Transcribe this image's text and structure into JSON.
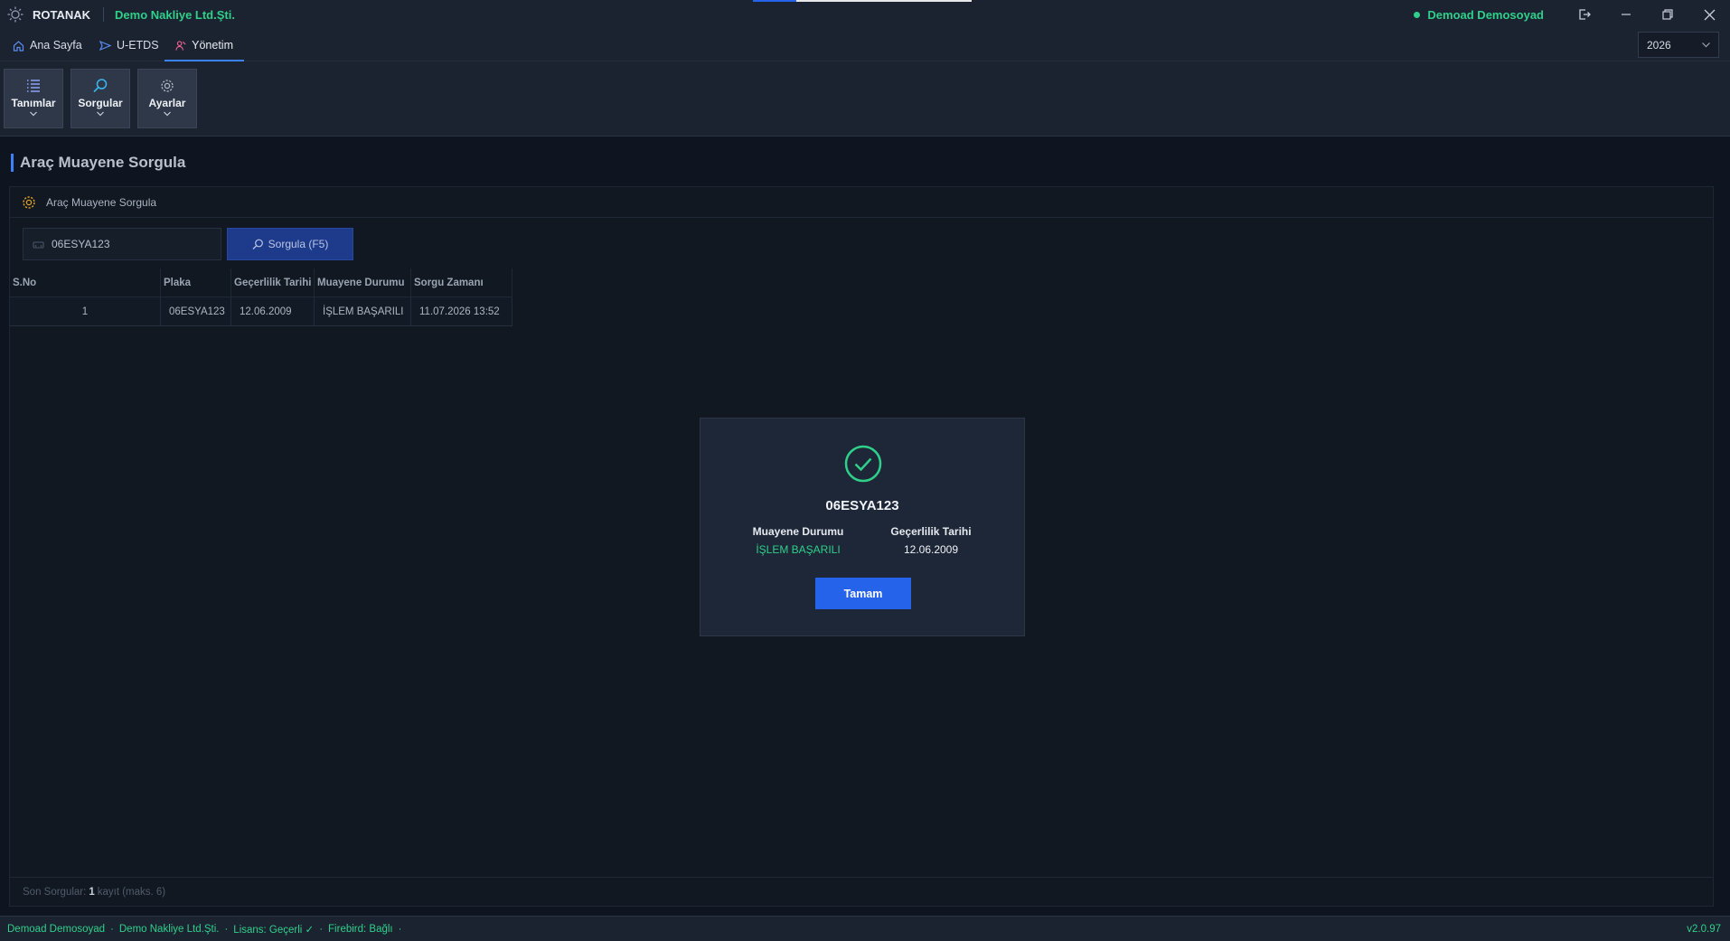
{
  "titlebar": {
    "app_name": "ROTANAK",
    "company": "Demo Nakliye Ltd.Şti.",
    "user": "Demoad Demosoyad"
  },
  "menu": {
    "tabs": [
      {
        "label": "Ana Sayfa",
        "icon": "home-icon"
      },
      {
        "label": "U-ETDS",
        "icon": "send-icon"
      },
      {
        "label": "Yönetim",
        "icon": "admin-icon",
        "active": true
      }
    ],
    "year": "2026"
  },
  "ribbon": {
    "buttons": [
      {
        "label": "Tanımlar",
        "icon": "list-icon"
      },
      {
        "label": "Sorgular",
        "icon": "search-icon"
      },
      {
        "label": "Ayarlar",
        "icon": "gear-icon"
      }
    ]
  },
  "page": {
    "title": "Araç Muayene Sorgula",
    "panel_title": "Araç Muayene Sorgula",
    "plate_value": "06ESYA123",
    "query_button": "Sorgula (F5)"
  },
  "table": {
    "columns": [
      "S.No",
      "Plaka",
      "Geçerlilik Tarihi",
      "Muayene Durumu",
      "Sorgu Zamanı"
    ],
    "rows": [
      [
        "1",
        "06ESYA123",
        "12.06.2009",
        "İŞLEM BAŞARILI",
        "11.07.2026 13:52"
      ]
    ]
  },
  "footer": {
    "prefix": "Son Sorgular:",
    "count": "1",
    "suffix": "kayıt (maks. 6)"
  },
  "dialog": {
    "plate": "06ESYA123",
    "status_label": "Muayene Durumu",
    "status_value": "İŞLEM BAŞARILI",
    "date_label": "Geçerlilik Tarihi",
    "date_value": "12.06.2009",
    "ok_button": "Tamam"
  },
  "statusbar": {
    "user": "Demoad Demosoyad",
    "company": "Demo Nakliye Ltd.Şti.",
    "license": "Lisans: Geçerli ✓",
    "db": "Firebird: Bağlı",
    "version": "v2.0.97"
  },
  "colors": {
    "accent": "#2563eb",
    "success": "#2fd08a",
    "background": "#0f1520",
    "bar": "#1b2230"
  }
}
